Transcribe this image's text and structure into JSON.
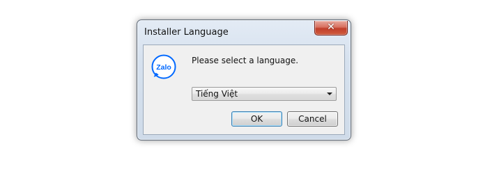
{
  "window": {
    "title": "Installer Language",
    "close_glyph": "✕"
  },
  "content": {
    "app_icon": "zalo-logo-icon",
    "logo_text": "Zalo",
    "prompt": "Please select a language.",
    "language_select": {
      "value": "Tiếng Việt"
    }
  },
  "buttons": {
    "ok": "OK",
    "cancel": "Cancel"
  },
  "colors": {
    "brand_blue": "#0068ff",
    "close_red": "#c13f2b"
  }
}
